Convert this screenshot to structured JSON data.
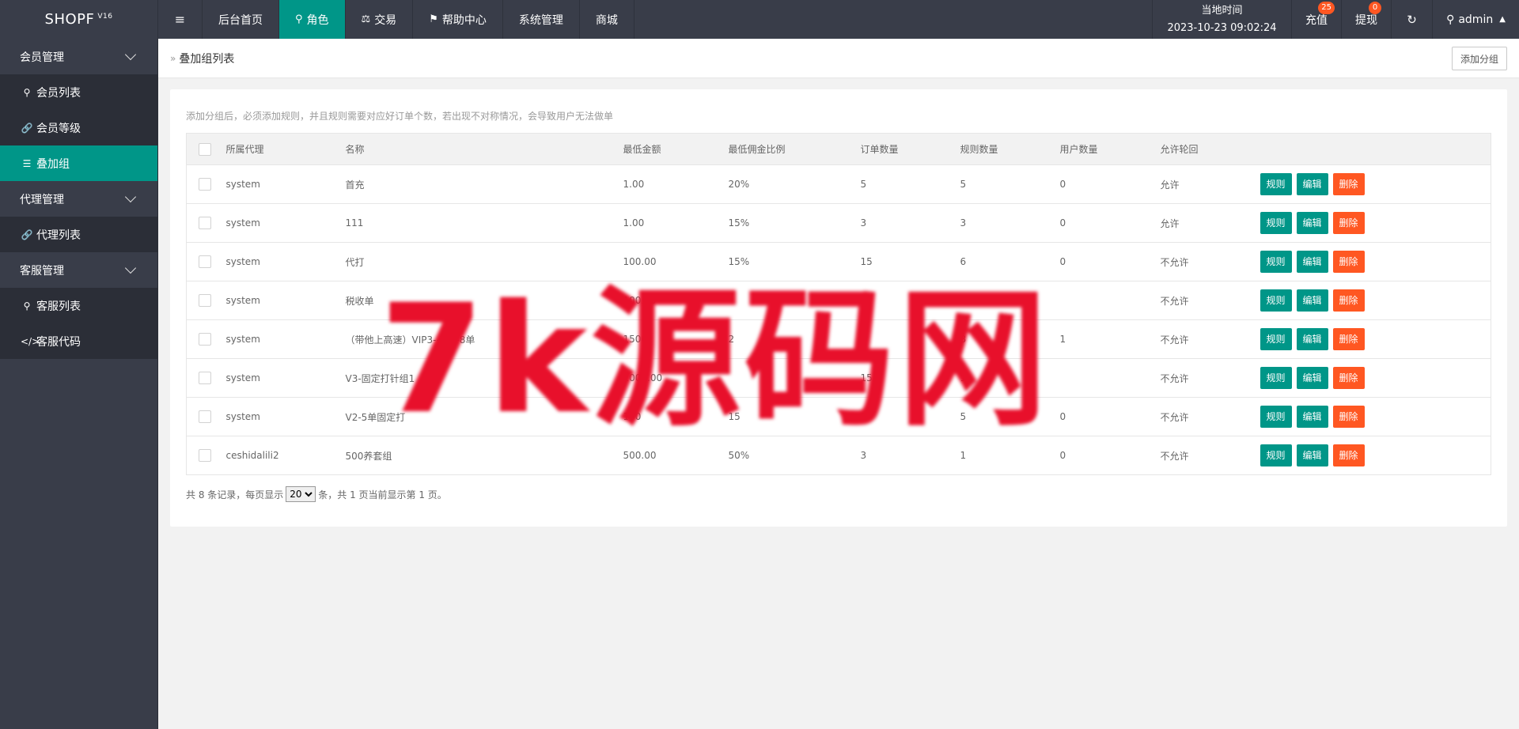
{
  "header": {
    "logo": "SHOPF",
    "logo_version": "V16",
    "nav": [
      {
        "label": "后台首页"
      },
      {
        "label": "角色"
      },
      {
        "label": "交易"
      },
      {
        "label": "帮助中心"
      },
      {
        "label": "系统管理"
      },
      {
        "label": "商城"
      }
    ],
    "time_label": "当地时间",
    "time_value": "2023-10-23 09:02:24",
    "recharge_label": "充值",
    "recharge_badge": "25",
    "withdraw_label": "提现",
    "withdraw_badge": "0",
    "user": "admin"
  },
  "sidebar": {
    "groups": [
      {
        "label": "会员管理",
        "items": [
          {
            "label": "会员列表"
          },
          {
            "label": "会员等级"
          },
          {
            "label": "叠加组"
          }
        ]
      },
      {
        "label": "代理管理",
        "items": [
          {
            "label": "代理列表"
          }
        ]
      },
      {
        "label": "客服管理",
        "items": [
          {
            "label": "客服列表"
          },
          {
            "label": "客服代码"
          }
        ]
      }
    ]
  },
  "page": {
    "breadcrumb": "叠加组列表",
    "add_button": "添加分组",
    "notice": "添加分组后，必须添加规则，并且规则需要对应好订单个数，若出现不对称情况，会导致用户无法做单"
  },
  "table": {
    "columns": [
      "所属代理",
      "名称",
      "最低金额",
      "最低佣金比例",
      "订单数量",
      "规则数量",
      "用户数量",
      "允许轮回"
    ],
    "actions": {
      "rules": "规则",
      "edit": "编辑",
      "delete": "删除"
    },
    "rows": [
      {
        "agent": "system",
        "name": "首充",
        "min_amount": "1.00",
        "min_rate": "20%",
        "orders": "5",
        "rules": "5",
        "users": "0",
        "loop": "允许"
      },
      {
        "agent": "system",
        "name": "111",
        "min_amount": "1.00",
        "min_rate": "15%",
        "orders": "3",
        "rules": "3",
        "users": "0",
        "loop": "允许"
      },
      {
        "agent": "system",
        "name": "代打",
        "min_amount": "100.00",
        "min_rate": "15%",
        "orders": "15",
        "rules": "6",
        "users": "0",
        "loop": "不允许"
      },
      {
        "agent": "system",
        "name": "税收单",
        "min_amount": "100.00",
        "min_rate": "",
        "orders": "",
        "rules": "3",
        "users": "",
        "loop": "不允许"
      },
      {
        "agent": "system",
        "name": "（带他上高速）VIP3---转--8单",
        "min_amount": "1500",
        "min_rate": "2",
        "orders": "",
        "rules": "8",
        "users": "1",
        "loop": "不允许"
      },
      {
        "agent": "system",
        "name": "V3-固定打针组1",
        "min_amount": "1000.00",
        "min_rate": "",
        "orders": "15",
        "rules": "1",
        "users": "",
        "loop": "不允许"
      },
      {
        "agent": "system",
        "name": "V2-5单固定打",
        "min_amount": "100",
        "min_rate": "15",
        "orders": "5",
        "rules": "5",
        "users": "0",
        "loop": "不允许"
      },
      {
        "agent": "ceshidalili2",
        "name": "500养套组",
        "min_amount": "500.00",
        "min_rate": "50%",
        "orders": "3",
        "rules": "1",
        "users": "0",
        "loop": "不允许"
      }
    ]
  },
  "pager": {
    "prefix": "共 8 条记录，每页显示",
    "page_size": "20",
    "suffix": "条，共 1 页当前显示第 1 页。"
  },
  "watermark": "7k源码网"
}
